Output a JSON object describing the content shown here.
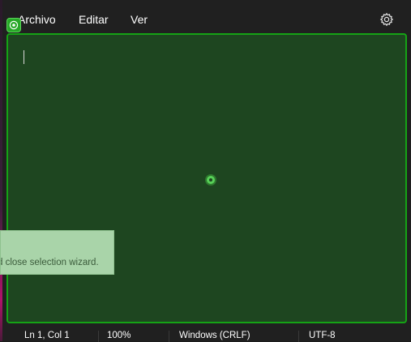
{
  "menubar": {
    "items": [
      {
        "label": "Archivo"
      },
      {
        "label": "Editar"
      },
      {
        "label": "Ver"
      }
    ],
    "settings_icon": "gear-icon"
  },
  "editor": {
    "content": ""
  },
  "selection_wizard": {
    "tooltip_text": "d close selection wizard."
  },
  "statusbar": {
    "position": "Ln 1, Col 1",
    "zoom": "100%",
    "line_ending": "Windows (CRLF)",
    "encoding": "UTF-8"
  },
  "colors": {
    "overlay_fill": "#1e4620",
    "overlay_border": "#15a315",
    "tooltip_bg": "#a9d4a9"
  }
}
